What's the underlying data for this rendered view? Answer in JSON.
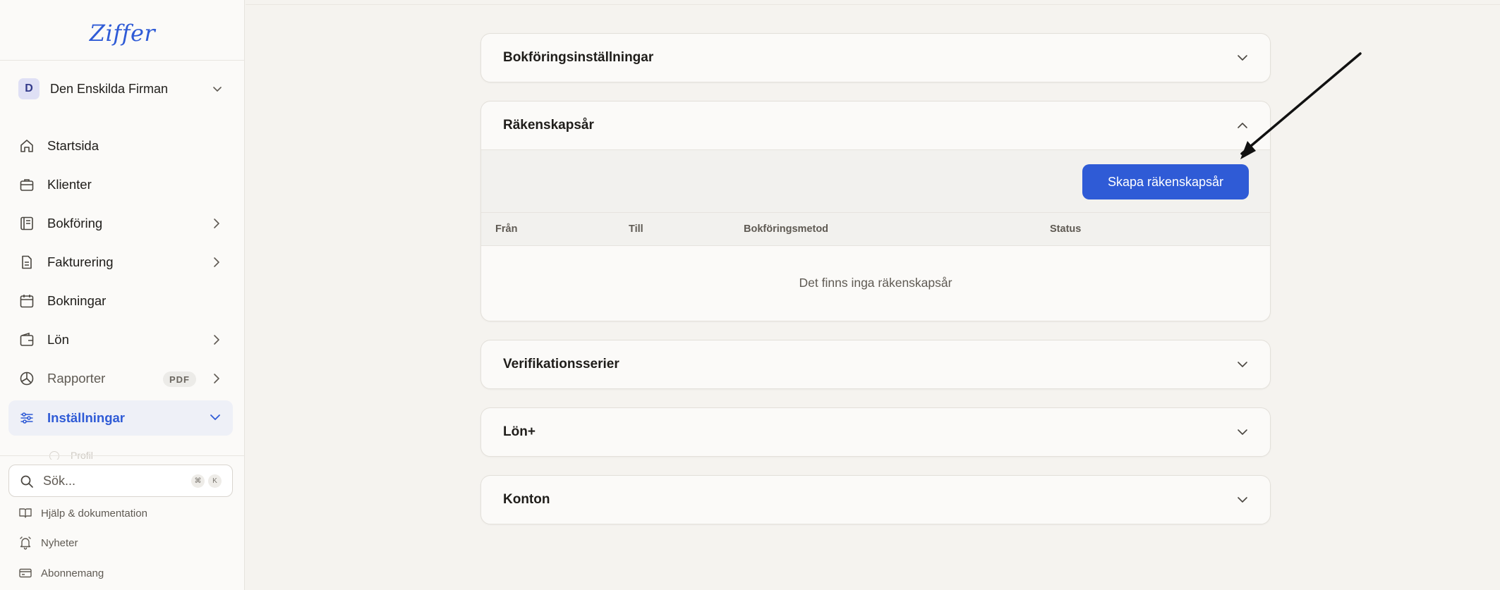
{
  "sidebar": {
    "logo": "Ziffer",
    "company": {
      "initial": "D",
      "name": "Den Enskilda Firman"
    },
    "nav": [
      {
        "label": "Startsida"
      },
      {
        "label": "Klienter"
      },
      {
        "label": "Bokföring"
      },
      {
        "label": "Fakturering"
      },
      {
        "label": "Bokningar"
      },
      {
        "label": "Lön"
      },
      {
        "label": "Rapporter",
        "badge": "PDF"
      },
      {
        "label": "Inställningar"
      }
    ],
    "faded_item": "Profil",
    "search": {
      "placeholder": "Sök...",
      "kbd": [
        "⌘",
        "K"
      ]
    },
    "footer": [
      {
        "label": "Hjälp & dokumentation"
      },
      {
        "label": "Nyheter"
      },
      {
        "label": "Abonnemang"
      }
    ]
  },
  "main": {
    "panels": [
      {
        "title": "Bokföringsinställningar"
      },
      {
        "title": "Räkenskapsår",
        "button": "Skapa räkenskapsår",
        "columns": [
          "Från",
          "Till",
          "Bokföringsmetod",
          "Status"
        ],
        "empty_text": "Det finns inga räkenskapsår"
      },
      {
        "title": "Verifikationsserier"
      },
      {
        "title": "Lön+"
      },
      {
        "title": "Konton"
      }
    ]
  },
  "colors": {
    "accent": "#2f5bd6",
    "sidebar_bg": "#fbfaf8",
    "page_bg": "#f5f3ef",
    "active_bg": "#eef0f7"
  }
}
